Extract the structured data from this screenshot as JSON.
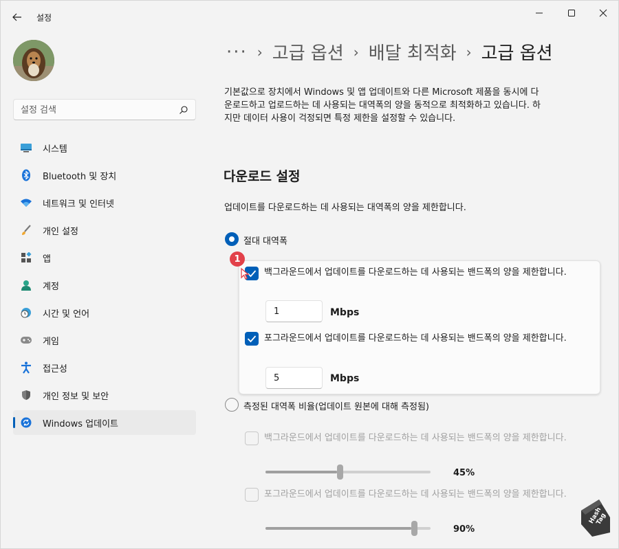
{
  "window": {
    "title": "설정",
    "minimize_icon": "minimize-icon",
    "maximize_icon": "maximize-icon",
    "close_icon": "close-icon"
  },
  "search": {
    "placeholder": "설정 검색"
  },
  "sidebar": {
    "items": [
      {
        "label": "시스템",
        "icon": "system-display-icon",
        "active": false
      },
      {
        "label": "Bluetooth 및 장치",
        "icon": "bluetooth-icon",
        "active": false
      },
      {
        "label": "네트워크 및 인터넷",
        "icon": "wifi-icon",
        "active": false
      },
      {
        "label": "개인 설정",
        "icon": "paintbrush-icon",
        "active": false
      },
      {
        "label": "앱",
        "icon": "apps-icon",
        "active": false
      },
      {
        "label": "계정",
        "icon": "account-icon",
        "active": false
      },
      {
        "label": "시간 및 언어",
        "icon": "clock-globe-icon",
        "active": false
      },
      {
        "label": "게임",
        "icon": "gamepad-icon",
        "active": false
      },
      {
        "label": "접근성",
        "icon": "accessibility-icon",
        "active": false
      },
      {
        "label": "개인 정보 및 보안",
        "icon": "shield-icon",
        "active": false
      },
      {
        "label": "Windows 업데이트",
        "icon": "windows-update-icon",
        "active": true
      }
    ],
    "accent": "#005fb8"
  },
  "breadcrumb": {
    "overflow": "···",
    "items": [
      "고급 옵션",
      "배달 최적화",
      "고급 옵션"
    ]
  },
  "intro_text": "기본값으로 장치에서 Windows 및 앱 업데이트와 다른 Microsoft 제품을 동시에 다운로드하고 업로드하는 데 사용되는 대역폭의 양을 동적으로 최적화하고 있습니다. 하지만 데이터 사용이 걱정되면 특정 제한을 설정할 수 있습니다.",
  "download_settings": {
    "title": "다운로드 설정",
    "description": "업데이트를 다운로드하는 데 사용되는 대역폭의 양을 제한합니다.",
    "absolute": {
      "label": "절대 대역폭",
      "selected": true,
      "badge": "1",
      "background_limit": {
        "checked": true,
        "label": "백그라운드에서 업데이트를 다운로드하는 데 사용되는 밴드폭의 양을 제한합니다.",
        "value": "1",
        "unit": "Mbps"
      },
      "foreground_limit": {
        "checked": true,
        "label": "포그라운드에서 업데이트를 다운로드하는 데 사용되는 밴드폭의 양을 제한합니다.",
        "value": "5",
        "unit": "Mbps"
      }
    },
    "percentage": {
      "label": "측정된 대역폭 비율(업데이트 원본에 대해 측정됨)",
      "selected": false,
      "background_limit": {
        "checked": false,
        "label": "백그라운드에서 업데이트를 다운로드하는 데 사용되는 밴드폭의 양을 제한합니다.",
        "percent_label": "45%",
        "level": 0.45
      },
      "foreground_limit": {
        "checked": false,
        "label": "포그라운드에서 업데이트를 다운로드하는 데 사용되는 밴드폭의 양을 제한합니다.",
        "percent_label": "90%",
        "level": 0.9
      }
    }
  },
  "watermark": "Hash Tag"
}
